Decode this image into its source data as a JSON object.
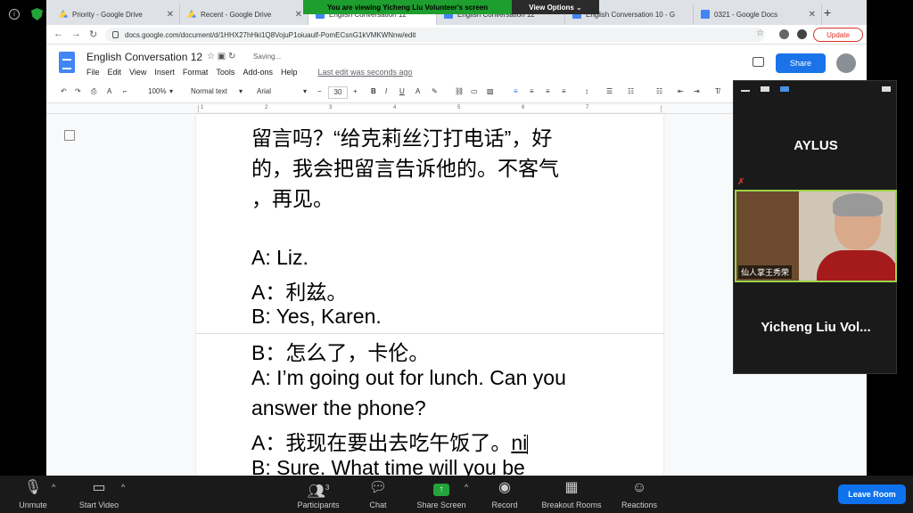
{
  "zoom": {
    "banner": "You are viewing Yicheng Liu Volunteer's screen",
    "view_options": "View Options ⌄",
    "bottom_bar": {
      "unmute": "Unmute",
      "start_video": "Start Video",
      "participants": "Participants",
      "participants_count": "3",
      "chat": "Chat",
      "share_screen": "Share Screen",
      "record": "Record",
      "breakout_rooms": "Breakout Rooms",
      "reactions": "Reactions",
      "leave_room": "Leave Room"
    },
    "panel": {
      "participant_1": "AYLUS",
      "participant_2_label": "仙人掌王秀荣",
      "participant_3": "Yicheng Liu Vol..."
    }
  },
  "browser": {
    "tabs": [
      {
        "title": "Priority - Google Drive",
        "icon": "drive-icon"
      },
      {
        "title": "Recent - Google Drive",
        "icon": "drive-icon"
      },
      {
        "title": "English Conversation 12",
        "icon": "docs-icon"
      },
      {
        "title": "English Conversation 12",
        "icon": "docs-icon"
      },
      {
        "title": "English Conversation 10 - G",
        "icon": "docs-icon"
      },
      {
        "title": "0321 - Google Docs",
        "icon": "docs-icon"
      }
    ],
    "url": "docs.google.com/document/d/1HHX27hHki1Q8VojuP1oiuaulf-PomECsnG1kVMKWNnw/edit",
    "update": "Update"
  },
  "docs": {
    "title": "English Conversation 12",
    "saving": "Saving...",
    "menu": [
      "File",
      "Edit",
      "View",
      "Insert",
      "Format",
      "Tools",
      "Add-ons",
      "Help"
    ],
    "last_edit": "Last edit was seconds ago",
    "share": "Share",
    "toolbar": {
      "zoom": "100%",
      "style": "Normal text",
      "font": "Arial",
      "font_size": "30"
    },
    "ruler_numbers": [
      "1",
      "2",
      "3",
      "4",
      "5",
      "6",
      "7"
    ],
    "lines": [
      "留言吗？“给克莉丝汀打电话”，好",
      "的，我会把留言告诉他的。不客气",
      "，再见。",
      "A: Liz.",
      "A：利兹。",
      "B: Yes, Karen.",
      "B：怎么了，卡伦。",
      "A: I’m going out for lunch. Can you",
      "answer the phone?",
      "A：我现在要出去吃午饭了。",
      "B: Sure. What time will you be"
    ],
    "typed_text": "ni"
  }
}
